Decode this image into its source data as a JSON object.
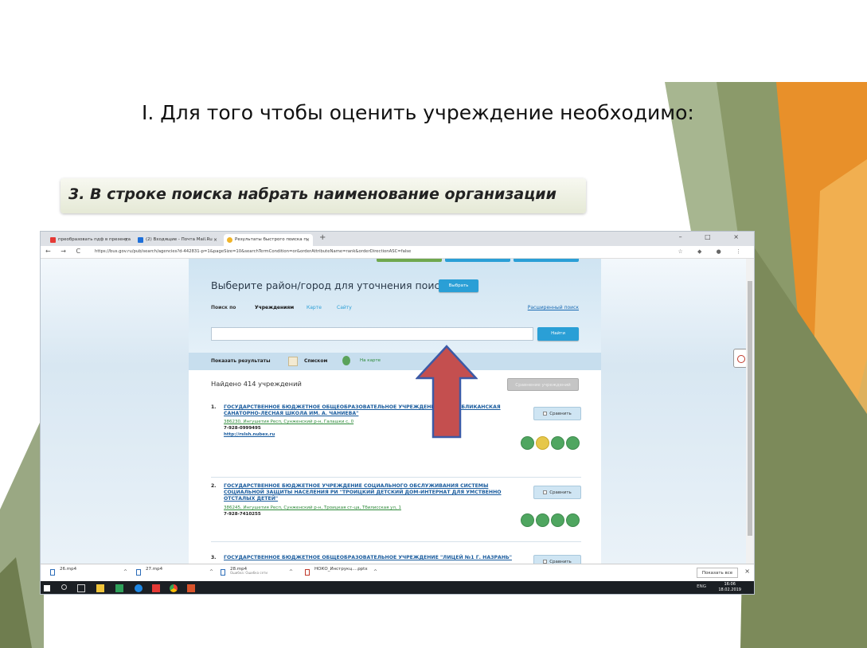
{
  "slide": {
    "title": "I. Для того чтобы оценить учреждение необходимо:",
    "subtitle": "3. В строке поиска набрать наименование организации",
    "colors": {
      "green_dark": "#7c8a5a",
      "green_light": "#a7b690",
      "orange": "#e8902a",
      "orange_light": "#f2b65a",
      "arrow_fill": "#c44f4f",
      "arrow_stroke": "#3c5aa6"
    }
  },
  "browser": {
    "tabs": [
      {
        "label": "преобразовать пдф в презента",
        "close": "×",
        "icon": "yandex-icon"
      },
      {
        "label": "(2) Входящие - Почта Mail.Ru",
        "close": "×",
        "icon": "mail-icon"
      },
      {
        "label": "Результаты быстрого поиска п",
        "close": "×",
        "icon": "bus-gov-icon"
      }
    ],
    "new_tab": "+",
    "window_controls": "– □ ×",
    "nav": "← → C",
    "url": "https://bus.gov.ru/pub/search/agencies?d-442831-p=1&pageSize=10&searchTermCondition=or&orderAttributeName=rank&orderDirectionASC=false",
    "toolbar_icons": "☆ ◆ ● ⋮"
  },
  "page": {
    "region_prompt": "Выберите район/город для уточнения поиска",
    "select_button": "Выбрать",
    "search_by": "Поиск по",
    "search_tabs": [
      "Учреждениям",
      "Карте",
      "Сайту"
    ],
    "extended_search": "Расширенный поиск",
    "search_placeholder": "",
    "find_button": "Найти",
    "show_results": "Показать результаты",
    "list_label": "Списком",
    "map_label": "На карте",
    "found": "Найдено 414 учреждений",
    "compare_all": "Сравнение учреждений",
    "compare": "Сравнить",
    "results": [
      {
        "num": "1.",
        "name": "ГОСУДАРСТВЕННОЕ БЮДЖЕТНОЕ ОБЩЕОБРАЗОВАТЕЛЬНОЕ УЧРЕЖДЕНИЕ \"РЕСПУБЛИКАНСКАЯ САНАТОРНО-ЛЕСНАЯ ШКОЛА ИМ. А. ЧАНИЕВА\"",
        "address": "386230, Ингушетия Респ, Сунженский р-н, Галашки с, 0",
        "phone": "7-928-0999495",
        "site": "http://rslsh.nubex.ru"
      },
      {
        "num": "2.",
        "name": "ГОСУДАРСТВЕННОЕ БЮДЖЕТНОЕ УЧРЕЖДЕНИЕ СОЦИАЛЬНОГО ОБСЛУЖИВАНИЯ СИСТЕМЫ СОЦИАЛЬНОЙ ЗАЩИТЫ НАСЕЛЕНИЯ РИ \"ТРОИЦКИЙ ДЕТСКИЙ ДОМ-ИНТЕРНАТ ДЛЯ УМСТВЕННО ОТСТАЛЫХ ДЕТЕЙ\"",
        "address": "386245, Ингушетия Респ, Сунженский р-н, Троицкая ст-ца, Тбилисская ул, 1",
        "phone": "7-928-7410255",
        "site": ""
      },
      {
        "num": "3.",
        "name": "ГОСУДАРСТВЕННОЕ БЮДЖЕТНОЕ ОБЩЕОБРАЗОВАТЕЛЬНОЕ УЧРЕЖДЕНИЕ \"ЛИЦЕЙ №1 Г. НАЗРАНЬ\"",
        "address": "",
        "phone": "",
        "site": ""
      }
    ]
  },
  "downloads": {
    "items": [
      {
        "name": "26.mp4",
        "sub": ""
      },
      {
        "name": "27.mp4",
        "sub": ""
      },
      {
        "name": "28.mp4",
        "sub": "Ошибка: Ошибка сети"
      },
      {
        "name": "НОКО_Инструкц....pptx",
        "sub": ""
      }
    ],
    "show_all": "Показать все",
    "close": "×"
  },
  "taskbar": {
    "lang": "ENG",
    "time": "16:06",
    "date": "18.02.2019"
  }
}
